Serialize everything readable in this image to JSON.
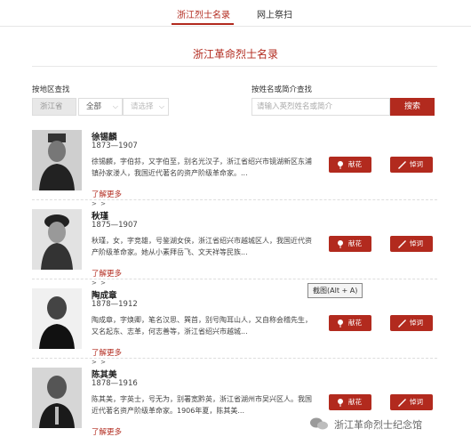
{
  "tabs": [
    {
      "label": "浙江烈士名录",
      "active": true
    },
    {
      "label": "网上祭扫",
      "active": false
    }
  ],
  "page_title": "浙江革命烈士名录",
  "filter": {
    "region_label": "按地区查找",
    "province": "浙江省",
    "city": "全部",
    "district": "请选择",
    "name_label": "按姓名或简介查找",
    "search_placeholder": "请输入英烈姓名或简介",
    "search_button": "搜索"
  },
  "martyrs": [
    {
      "name": "徐锡麟",
      "years": "1873—1907",
      "desc": "徐锡麟，字伯荪，又字伯至，别名光汉子，浙江省绍兴市镜湖新区东浦镇孙家溇人，我国近代著名的资产阶级革命家。...",
      "more": "了解更多",
      "arrows": "> >",
      "btn_flower": "献花",
      "btn_tribute": "悼词"
    },
    {
      "name": "秋瑾",
      "years": "1875—1907",
      "desc": "秋瑾，女，字竞雄，号鉴湖女侠，浙江省绍兴市越城区人，我国近代资产阶级革命家。她从小素拜岳飞、文天祥等民族...",
      "more": "了解更多",
      "arrows": "> >",
      "btn_flower": "献花",
      "btn_tribute": "悼词"
    },
    {
      "name": "陶成章",
      "years": "1878—1912",
      "desc": "陶成章，字焕卿，笔名汉思、巽首，别号陶耳山人，又自称会稽先生，又名起东、志革，何志善等，浙江省绍兴市越城...",
      "more": "了解更多",
      "arrows": "> >",
      "btn_flower": "献花",
      "btn_tribute": "悼词"
    },
    {
      "name": "陈其美",
      "years": "1878—1916",
      "desc": "陈其美，字英士，号无为，别署宽黔英，浙江省湖州市吴兴区人。我国近代著名资产阶级革命家。1906年夏，陈其美...",
      "more": "了解更多",
      "arrows": "",
      "btn_flower": "献花",
      "btn_tribute": "悼词"
    }
  ],
  "tooltip": "截图(Alt + A)",
  "watermark": "浙江革命烈士纪念馆",
  "colors": {
    "accent": "#b22a1e"
  }
}
